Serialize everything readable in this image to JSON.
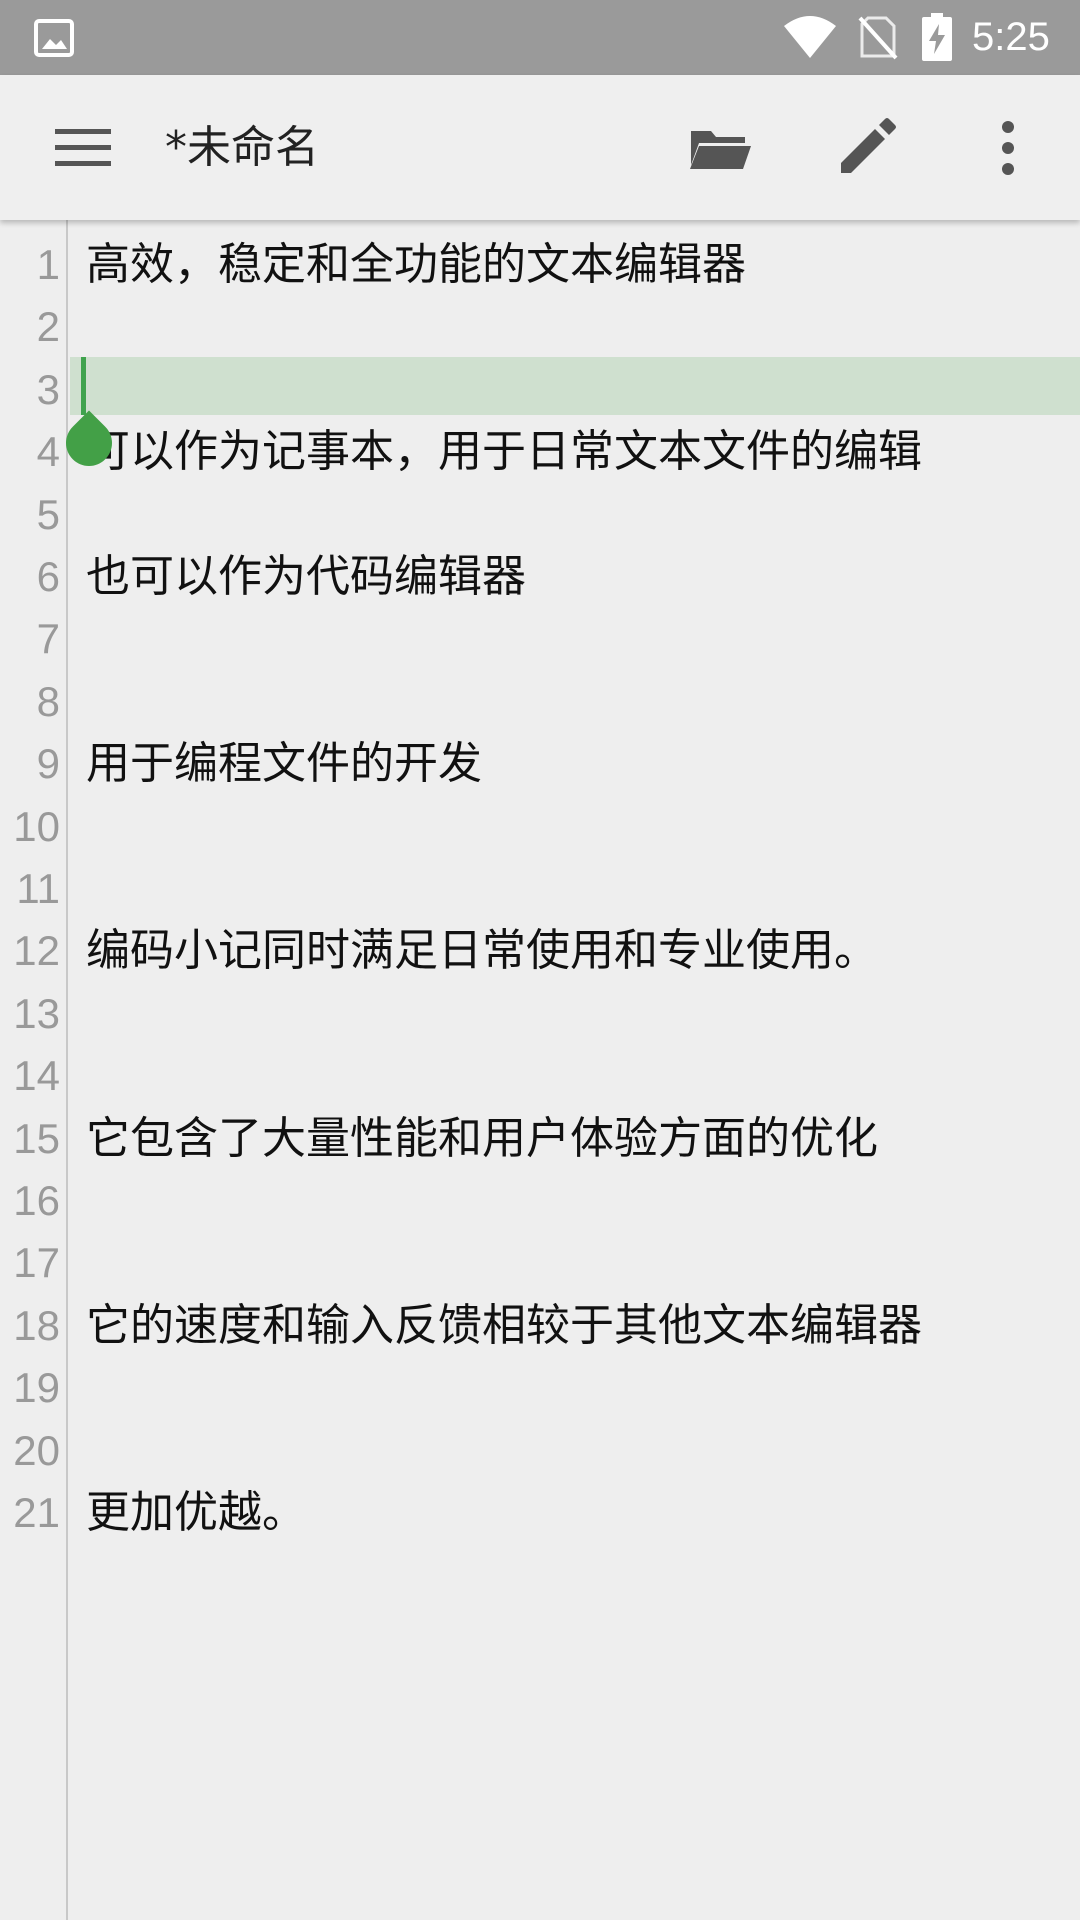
{
  "status_bar": {
    "time": "5:25",
    "icons": [
      "image-icon",
      "wifi-icon",
      "no-sim-icon",
      "battery-charging-icon"
    ]
  },
  "app_bar": {
    "title": "*未命名",
    "icons": [
      "menu-icon",
      "folder-open-icon",
      "pencil-icon",
      "more-vert-icon"
    ]
  },
  "editor": {
    "current_line": 3,
    "lines": [
      {
        "number": "1",
        "text": "高效，稳定和全功能的文本编辑器"
      },
      {
        "number": "2",
        "text": ""
      },
      {
        "number": "3",
        "text": ""
      },
      {
        "number": "4",
        "text": "可以作为记事本，用于日常文本文件的编辑"
      },
      {
        "number": "5",
        "text": ""
      },
      {
        "number": "6",
        "text": "也可以作为代码编辑器"
      },
      {
        "number": "7",
        "text": ""
      },
      {
        "number": "8",
        "text": ""
      },
      {
        "number": "9",
        "text": "用于编程文件的开发"
      },
      {
        "number": "10",
        "text": ""
      },
      {
        "number": "11",
        "text": ""
      },
      {
        "number": "12",
        "text": "编码小记同时满足日常使用和专业使用。"
      },
      {
        "number": "13",
        "text": ""
      },
      {
        "number": "14",
        "text": ""
      },
      {
        "number": "15",
        "text": "它包含了大量性能和用户体验方面的优化"
      },
      {
        "number": "16",
        "text": ""
      },
      {
        "number": "17",
        "text": ""
      },
      {
        "number": "18",
        "text": "它的速度和输入反馈相较于其他文本编辑器"
      },
      {
        "number": "19",
        "text": ""
      },
      {
        "number": "20",
        "text": ""
      },
      {
        "number": "21",
        "text": "更加优越。"
      }
    ]
  },
  "colors": {
    "status_bar": "#9a9a9a",
    "app_bar": "#efefef",
    "accent": "#43a047",
    "current_line_highlight": "#cfe0cf"
  }
}
